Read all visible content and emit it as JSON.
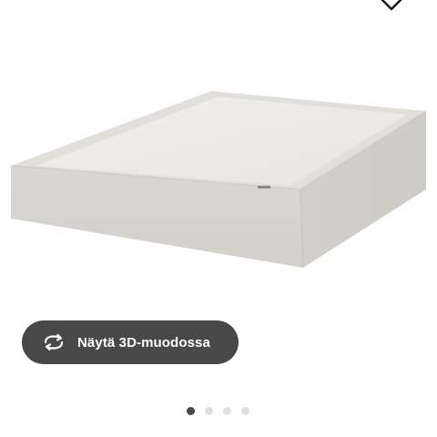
{
  "product": {
    "image_alt": "Jousipohja, beige"
  },
  "actions": {
    "view_3d_label": "Näytä 3D-muodossa",
    "view_3d_icon": "rotate-3d-icon",
    "favorite_icon": "heart-icon"
  },
  "carousel": {
    "total_images": 4,
    "active_index": 0
  },
  "colors": {
    "button_bg": "#484848",
    "button_text": "#ffffff",
    "dot_active": "#484848",
    "dot_inactive": "#dfdfdf"
  }
}
